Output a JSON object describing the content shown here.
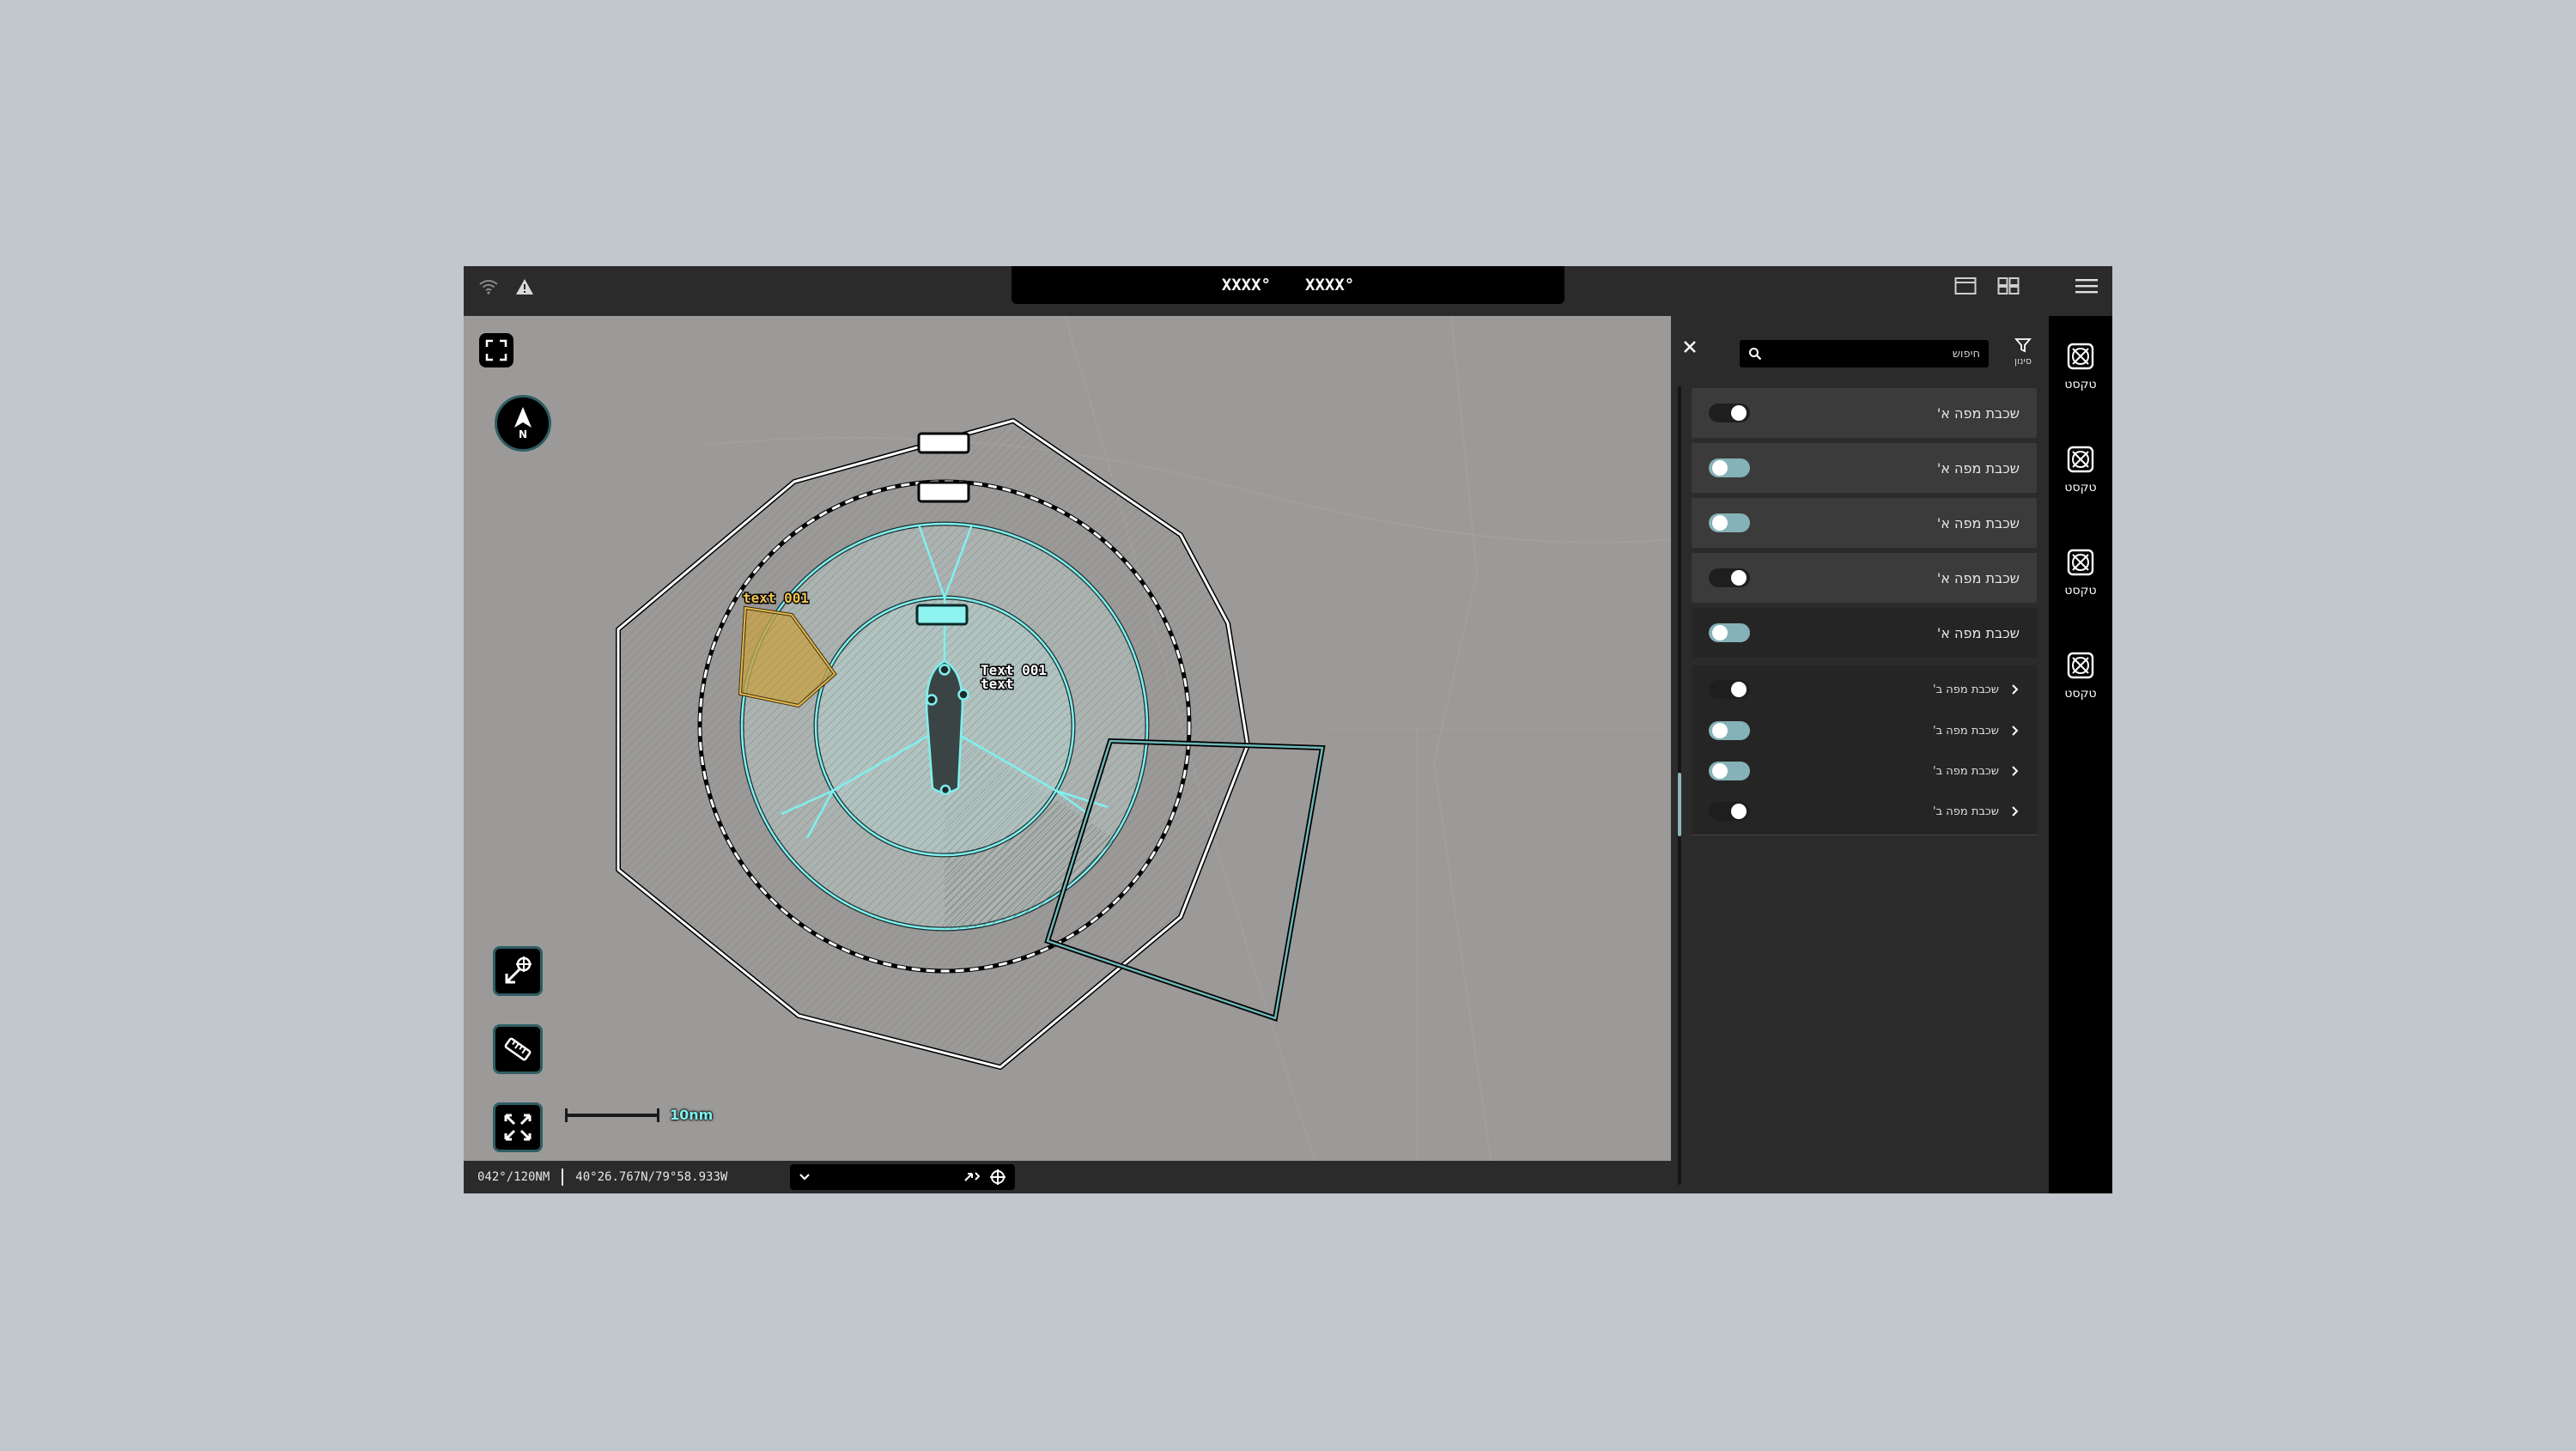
{
  "topbar": {
    "coord_left": "XXXX°",
    "coord_right": "XXXX°"
  },
  "map": {
    "compass_label": "N",
    "scale_label": "10nm",
    "label_yellow": "text 001",
    "label_center_line1": "Text 001",
    "label_center_line2": "text",
    "colors": {
      "accent": "#7ff0ef",
      "warning": "#e6b84a",
      "panel": "#2b2b2b"
    }
  },
  "status": {
    "bearing": "042°/120NM",
    "position": "40°26.767N/79°58.933W"
  },
  "panel": {
    "search_placeholder": "חיפוש",
    "filter_label": "סינון",
    "layers": [
      {
        "label": "שכבת מפה א'",
        "on": false
      },
      {
        "label": "שכבת מפה א'",
        "on": true
      },
      {
        "label": "שכבת מפה א'",
        "on": true
      },
      {
        "label": "שכבת מפה א'",
        "on": false
      },
      {
        "label": "שכבת מפה א'",
        "on": true
      }
    ],
    "sublayers": [
      {
        "label": "שכבת מפה ב'",
        "on": false
      },
      {
        "label": "שכבת מפה ב'",
        "on": true
      },
      {
        "label": "שכבת מפה ב'",
        "on": true
      },
      {
        "label": "שכבת מפה ב'",
        "on": false
      }
    ]
  },
  "rail": {
    "items": [
      {
        "label": "טקסט"
      },
      {
        "label": "טקסט"
      },
      {
        "label": "טקסט"
      },
      {
        "label": "טקסט"
      }
    ]
  }
}
